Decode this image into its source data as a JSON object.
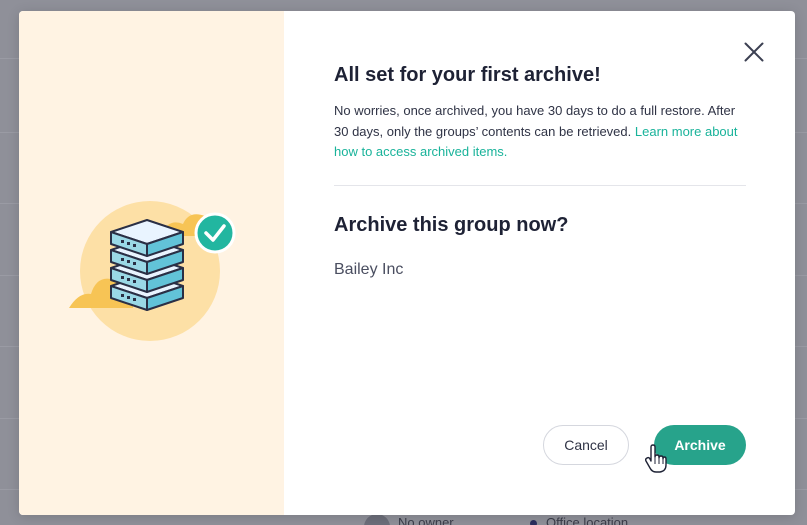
{
  "background": {
    "footer_owner": "No owner",
    "footer_location": "Office location"
  },
  "modal": {
    "close_icon": "close-icon",
    "illustration": "archive-server-check-illustration",
    "title": "All set for your first archive!",
    "description": "No worries, once archived, you have 30 days to do a full restore. After 30 days, only the groups’ contents can be retrieved. ",
    "learn_more_link": "Learn more about how to access archived items.",
    "question": "Archive this group now?",
    "group_name": "Bailey Inc",
    "cancel_label": "Cancel",
    "archive_label": "Archive",
    "colors": {
      "accent": "#27a38b",
      "link": "#19b39a",
      "illustration_bg": "#fff3e3"
    }
  }
}
